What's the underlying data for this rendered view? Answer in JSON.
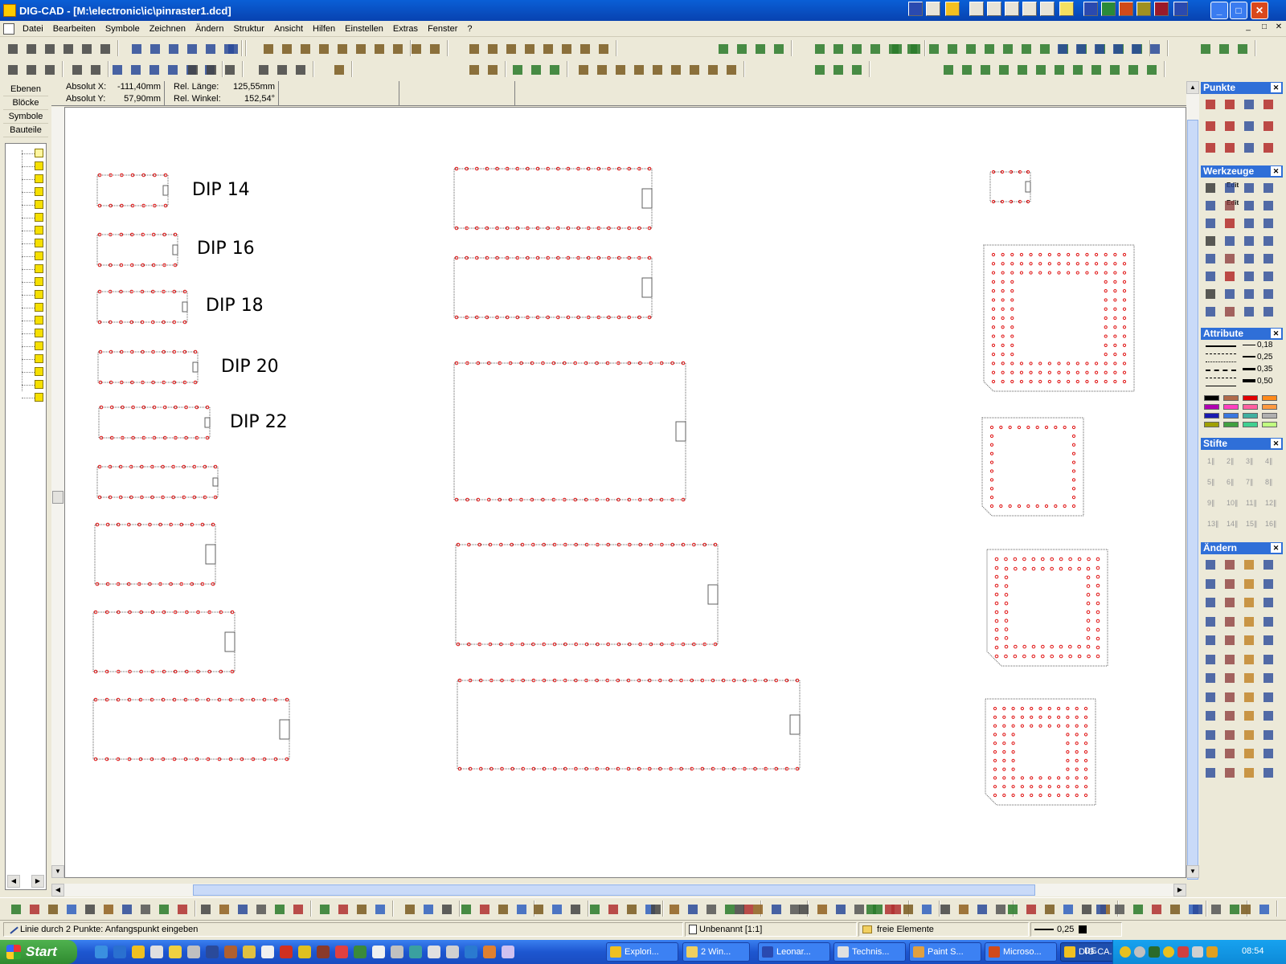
{
  "window": {
    "title": "DIG-CAD - [M:\\electronic\\ic\\pinraster1.dcd]",
    "minimize": "_",
    "maximize": "□",
    "close": "✕"
  },
  "menu": [
    "Datei",
    "Bearbeiten",
    "Symbole",
    "Zeichnen",
    "Ändern",
    "Struktur",
    "Ansicht",
    "Hilfen",
    "Einstellen",
    "Extras",
    "Fenster",
    "?"
  ],
  "left_tabs": [
    "Ebenen",
    "Blöcke",
    "Symbole",
    "Bauteile"
  ],
  "coords": {
    "abs_x_label": "Absolut X:",
    "abs_x_value": "-111,40mm",
    "abs_y_label": "Absolut Y:",
    "abs_y_value": "57,90mm",
    "rel_len_label": "Rel. Länge:",
    "rel_len_value": "125,55mm",
    "rel_angle_label": "Rel. Winkel:",
    "rel_angle_value": "152,54°"
  },
  "drawing": {
    "pin_color": "#e01010",
    "outline_color": "#606060",
    "labels": [
      "DIP 14",
      "DIP 16",
      "DIP 18",
      "DIP 20",
      "DIP 22"
    ]
  },
  "panels": {
    "punkte": "Punkte",
    "werkzeuge": "Werkzeuge",
    "attribute": "Attribute",
    "stifte": "Stifte",
    "aendern": "Ändern",
    "edit1": "Edit",
    "edit2": "Edit",
    "line_widths": [
      "0,18",
      "0,25",
      "0,35",
      "0,50"
    ],
    "pen_numbers": [
      "1",
      "2",
      "3",
      "4",
      "5",
      "6",
      "7",
      "8",
      "9",
      "10",
      "11",
      "12",
      "13",
      "14",
      "15",
      "16"
    ],
    "swatches": [
      "#000000",
      "#b06a4a",
      "#e00000",
      "#ff8a1a",
      "#b000b0",
      "#ff40c0",
      "#ff60a0",
      "#ff9a40",
      "#1a1ab0",
      "#3a78e0",
      "#40b0a0",
      "#b0b0b0",
      "#a0a000",
      "#40a040",
      "#40d090",
      "#c0ff80"
    ]
  },
  "status": {
    "hint": "Linie durch 2 Punkte: Anfangspunkt eingeben",
    "view": "Unbenannt [1:1]",
    "elements": "freie Elemente",
    "line_width": "0,25"
  },
  "taskbar": {
    "start": "Start",
    "tasks": [
      "Explori...",
      "2 Win...",
      "Leonar...",
      "Technis...",
      "Paint S...",
      "Microso...",
      "DIG-CA..."
    ],
    "lang": "DE",
    "clock": "08:54"
  }
}
